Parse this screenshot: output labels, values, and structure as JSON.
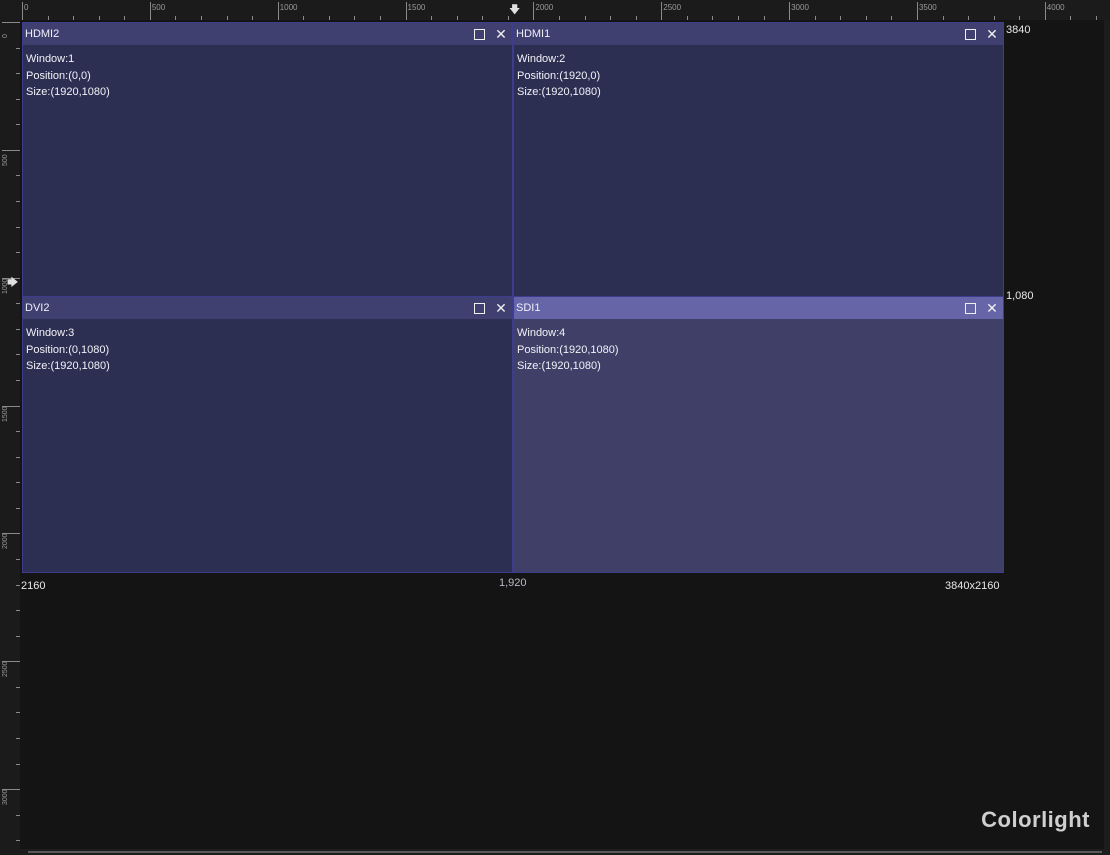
{
  "ruler": {
    "top_labels": [
      "0",
      "500",
      "1000",
      "1500",
      "2000",
      "2500",
      "3000",
      "3500",
      "4000"
    ],
    "left_labels": [
      "0",
      "500",
      "1000",
      "1500",
      "2000",
      "2500",
      "3000"
    ]
  },
  "windows": [
    {
      "title": "HDMI2",
      "window": "Window:1",
      "position": "Position:(0,0)",
      "size": "Size:(1920,1080)",
      "active": false
    },
    {
      "title": "HDMI1",
      "window": "Window:2",
      "position": "Position:(1920,0)",
      "size": "Size:(1920,1080)",
      "active": false
    },
    {
      "title": "DVI2",
      "window": "Window:3",
      "position": "Position:(0,1080)",
      "size": "Size:(1920,1080)",
      "active": false
    },
    {
      "title": "SDI1",
      "window": "Window:4",
      "position": "Position:(1920,1080)",
      "size": "Size:(1920,1080)",
      "active": true
    }
  ],
  "canvas_labels": {
    "width_label": "3840",
    "mid_height_label": "1,080",
    "height_label": "2160",
    "mid_width_label": "1,920",
    "resolution_label": "3840x2160"
  },
  "icons": {
    "maximize": "maximize-icon",
    "close": "close-icon"
  },
  "brand": "Colorlight"
}
